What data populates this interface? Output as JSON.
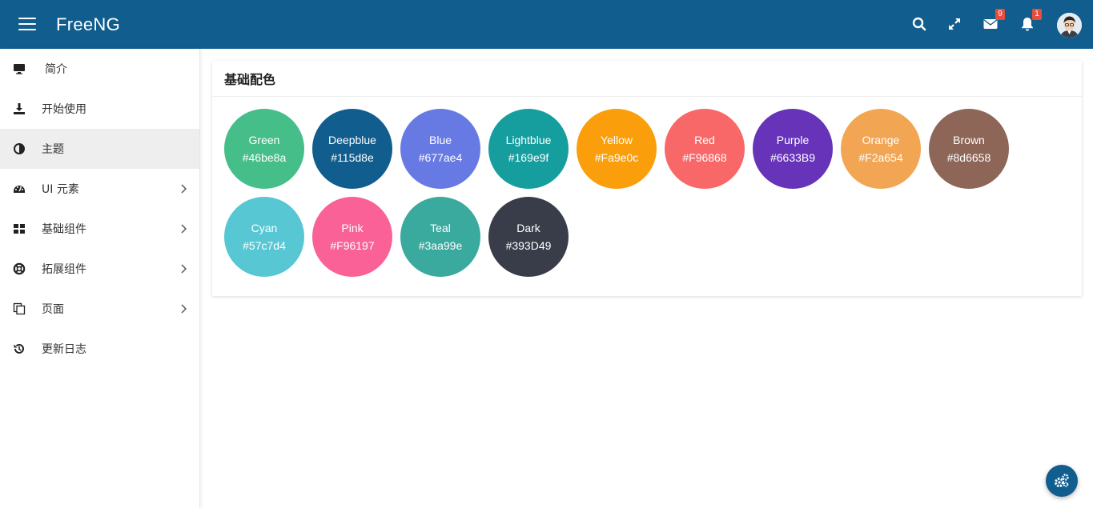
{
  "header": {
    "brand": "FreeNG",
    "mail_badge": "9",
    "bell_badge": "1"
  },
  "sidebar": {
    "items": [
      {
        "label": "简介",
        "icon": "monitor-icon",
        "chevron": false,
        "active": false
      },
      {
        "label": "开始使用",
        "icon": "download-icon",
        "chevron": false,
        "active": false
      },
      {
        "label": "主题",
        "icon": "adjust-icon",
        "chevron": false,
        "active": true
      },
      {
        "label": "UI 元素",
        "icon": "dashboard-icon",
        "chevron": true,
        "active": false
      },
      {
        "label": "基础组件",
        "icon": "grid-icon",
        "chevron": true,
        "active": false
      },
      {
        "label": "拓展组件",
        "icon": "life-ring-icon",
        "chevron": true,
        "active": false
      },
      {
        "label": "页面",
        "icon": "copy-icon",
        "chevron": true,
        "active": false
      },
      {
        "label": "更新日志",
        "icon": "history-icon",
        "chevron": false,
        "active": false
      }
    ]
  },
  "card": {
    "title": "基础配色",
    "colors": [
      {
        "name": "Green",
        "hex": "#46be8a",
        "fill": "#46be8a"
      },
      {
        "name": "Deepblue",
        "hex": "#115d8e",
        "fill": "#115d8e"
      },
      {
        "name": "Blue",
        "hex": "#677ae4",
        "fill": "#677ae4"
      },
      {
        "name": "Lightblue",
        "hex": "#169e9f",
        "fill": "#169e9f"
      },
      {
        "name": "Yellow",
        "hex": "#Fa9e0c",
        "fill": "#fa9e0c"
      },
      {
        "name": "Red",
        "hex": "#F96868",
        "fill": "#f96868"
      },
      {
        "name": "Purple",
        "hex": "#6633B9",
        "fill": "#6633b9"
      },
      {
        "name": "Orange",
        "hex": "#F2a654",
        "fill": "#f2a654"
      },
      {
        "name": "Brown",
        "hex": "#8d6658",
        "fill": "#8d6658"
      },
      {
        "name": "Cyan",
        "hex": "#57c7d4",
        "fill": "#57c7d4"
      },
      {
        "name": "Pink",
        "hex": "#F96197",
        "fill": "#f96197"
      },
      {
        "name": "Teal",
        "hex": "#3aa99e",
        "fill": "#3aa99e"
      },
      {
        "name": "Dark",
        "hex": "#393D49",
        "fill": "#393d49"
      }
    ]
  },
  "colors": {
    "header_bg": "#115d8e",
    "badge": "#e74c3c",
    "active_bg": "#eeeeee"
  }
}
